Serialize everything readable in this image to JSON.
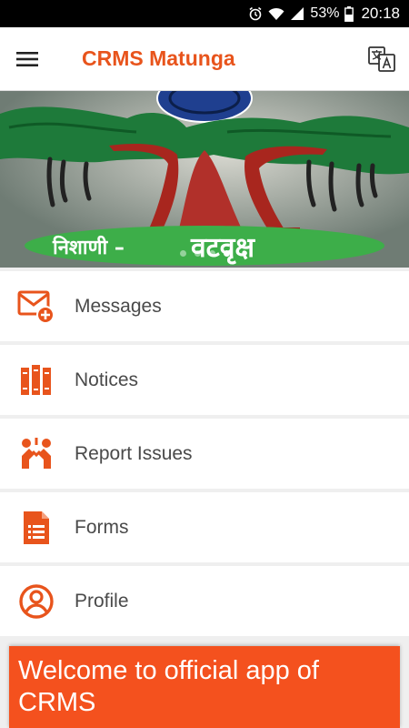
{
  "status_bar": {
    "battery": "53%",
    "time": "20:18",
    "icons": [
      "alarm-icon",
      "wifi-icon",
      "signal-icon",
      "battery-icon"
    ]
  },
  "app_bar": {
    "title": "CRMS Matunga",
    "menu_icon": "hamburger-menu-icon",
    "translate_icon": "translate-icon"
  },
  "banner": {
    "caption_left": "निशाणी –",
    "caption_right": "वटवृक्ष",
    "slides": 4,
    "active_slide": 4
  },
  "menu": {
    "items": [
      {
        "label": "Messages",
        "icon": "message-add-icon"
      },
      {
        "label": "Notices",
        "icon": "notices-icon"
      },
      {
        "label": "Report Issues",
        "icon": "report-issues-icon"
      },
      {
        "label": "Forms",
        "icon": "forms-icon"
      },
      {
        "label": "Profile",
        "icon": "profile-icon"
      }
    ]
  },
  "welcome": {
    "text": "Welcome to official app of CRMS"
  },
  "colors": {
    "accent": "#e8541c",
    "welcome_bg": "#f4511e"
  }
}
